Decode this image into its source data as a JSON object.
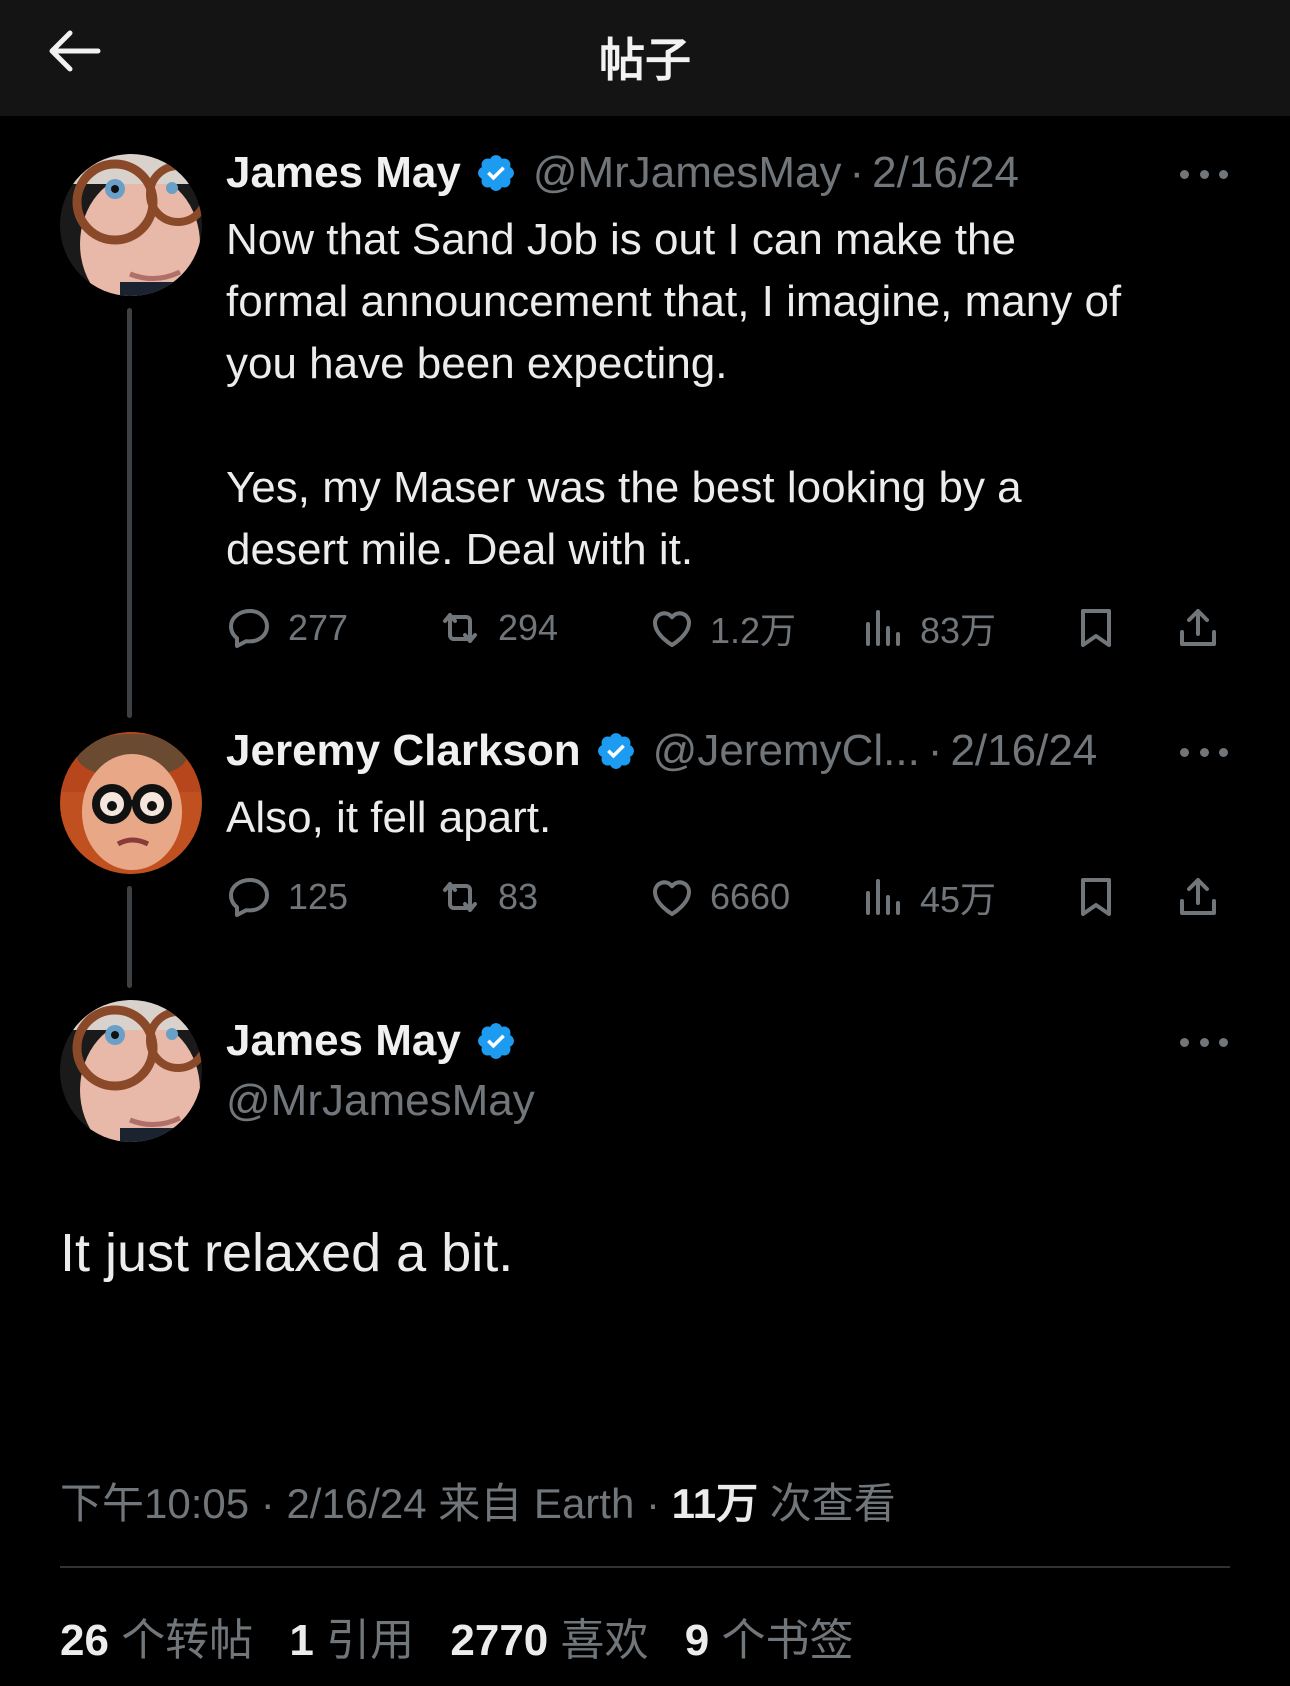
{
  "header": {
    "title": "帖子",
    "back_icon": "arrow-left-icon"
  },
  "colors": {
    "verified": "#1d9bf0",
    "muted": "#71767b",
    "text": "#e7e9ea",
    "background": "#000000"
  },
  "tweets": [
    {
      "name": "James May",
      "handle": "@MrJamesMay",
      "separator": "·",
      "date": "2/16/24",
      "text": "Now that Sand Job is out I can make the\nformal announcement that, I imagine, many of\nyou have been expecting.\n\nYes, my Maser was the best looking by a\ndesert mile. Deal with it.",
      "replies": "277",
      "retweets": "294",
      "likes": "1.2万",
      "views": "83万"
    },
    {
      "name": "Jeremy Clarkson",
      "handle": "@JeremyCl...",
      "separator": "·",
      "date": "2/16/24",
      "text": "Also, it fell apart.",
      "replies": "125",
      "retweets": "83",
      "likes": "6660",
      "views": "45万"
    }
  ],
  "main_tweet": {
    "name": "James May",
    "handle": "@MrJamesMay",
    "text": "It just relaxed a bit.",
    "time": "下午10:05",
    "sep1": "·",
    "date": "2/16/24",
    "source": "来自 Earth",
    "sep2": "·",
    "views_count": "11万",
    "views_label": "次查看"
  },
  "stats": {
    "retweets_count": "26",
    "retweets_label": "个转帖",
    "quotes_count": "1",
    "quotes_label": "引用",
    "likes_count": "2770",
    "likes_label": "喜欢",
    "bookmarks_count": "9",
    "bookmarks_label": "个书签"
  }
}
